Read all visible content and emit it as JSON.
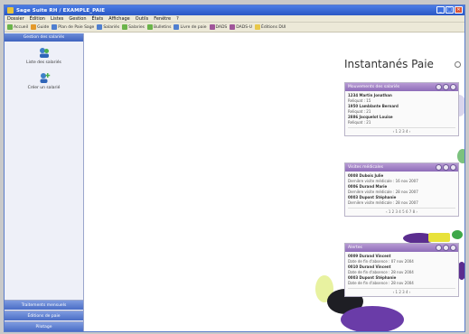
{
  "window": {
    "title": "Sage Suite RH / EXAMPLE_PAIE",
    "buttons": [
      "_",
      "□",
      "✕"
    ]
  },
  "menubar": {
    "items": [
      "Dossier",
      "Édition",
      "Listes",
      "Gestion",
      "États",
      "Affichage",
      "Outils",
      "Fenêtre",
      "?"
    ]
  },
  "toolbar": {
    "items": [
      {
        "label": "Accueil",
        "icon": "home-icon"
      },
      {
        "label": "Guide",
        "icon": "guide-icon"
      },
      {
        "label": "Plan de Paie Sage",
        "icon": "plan-icon"
      },
      {
        "label": "Salariés",
        "icon": "employees-icon"
      },
      {
        "label": "Salaries",
        "icon": "employee-icon"
      },
      {
        "label": "Bulletins",
        "icon": "payslip-icon"
      },
      {
        "label": "Livre de paie",
        "icon": "ledger-icon"
      },
      {
        "label": "DADS",
        "icon": "dads-icon"
      },
      {
        "label": "DADS-U",
        "icon": "dadsu-icon"
      },
      {
        "label": "Éditions DUI",
        "icon": "report-icon"
      }
    ]
  },
  "sidebar": {
    "header": "Gestion des salariés",
    "actions": [
      {
        "label": "Liste des salariés",
        "icon": "people-list-icon"
      },
      {
        "label": "Créer un salarié",
        "icon": "add-person-icon"
      }
    ],
    "bottom_buttons": [
      "Traitements mensuels",
      "Éditions de paie",
      "Pilotage"
    ]
  },
  "main": {
    "heading": "Instantanés Paie",
    "cards": [
      {
        "title": "Mouvements des salariés",
        "rows": [
          {
            "text": "1234 Martin Jonathan",
            "type": "name"
          },
          {
            "text": "Reliquat : 15",
            "type": "detail"
          },
          {
            "text": "1950 Lamblante Bernard",
            "type": "name"
          },
          {
            "text": "Reliquat : 21",
            "type": "detail"
          },
          {
            "text": "2886 Jacquelot Louise",
            "type": "name"
          },
          {
            "text": "Reliquat : 21",
            "type": "detail"
          }
        ],
        "pager": "‹ 1 2 3 4 ›"
      },
      {
        "title": "Visites médicales",
        "rows": [
          {
            "text": "0008 Dubois Julie",
            "type": "name"
          },
          {
            "text": "Dernière visite médicale : 16 nov 2007",
            "type": "detail"
          },
          {
            "text": "0006 Durand Marie",
            "type": "name"
          },
          {
            "text": "Dernière visite médicale : 28 nov 2007",
            "type": "detail"
          },
          {
            "text": "0003 Dupont Stéphanie",
            "type": "name"
          },
          {
            "text": "Dernière visite médicale : 28 nov 2007",
            "type": "detail"
          }
        ],
        "pager": "‹ 1 2 3 4 5 6 7 8 ›"
      },
      {
        "title": "Alertes",
        "rows": [
          {
            "text": "0009 Durand Vincent",
            "type": "name"
          },
          {
            "text": "Date de fin d'absence : 07 nov 2004",
            "type": "detail"
          },
          {
            "text": "0010 Durand Vincent",
            "type": "name"
          },
          {
            "text": "Date de fin d'absence : 28 nov 2004",
            "type": "detail"
          },
          {
            "text": "0003 Dupont Stéphanie",
            "type": "name"
          },
          {
            "text": "Date de fin d'absence : 28 nov 2004",
            "type": "detail"
          }
        ],
        "pager": "‹ 1 2 3 4 ›"
      }
    ]
  },
  "colors": {
    "titlebar": "#2a57c4",
    "card_header": "#8e6db8",
    "sidebar_button": "#4a6dc6",
    "deco_purple": "#5b2d8f",
    "deco_yellow": "#e8e23a",
    "deco_green": "#3ea84a"
  }
}
